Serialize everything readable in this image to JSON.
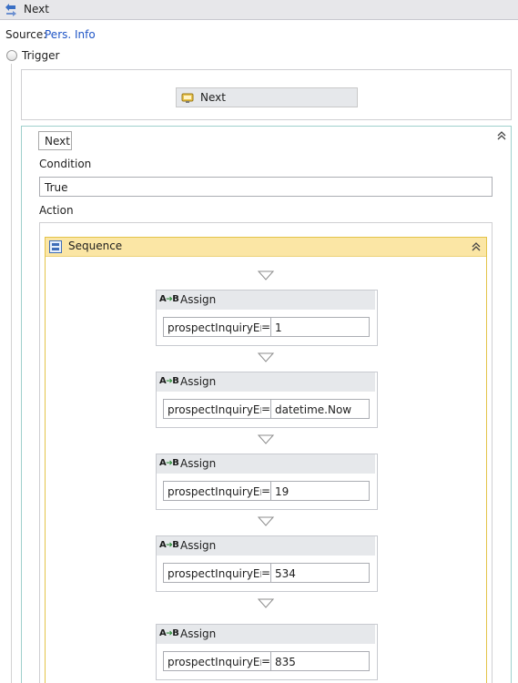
{
  "header": {
    "title": "Next",
    "icon": "transition-icon"
  },
  "source": {
    "label": "Source:",
    "link": "Pers. Info"
  },
  "trigger": {
    "label": "Trigger",
    "activity_label": "Next",
    "activity_icon": "trigger-activity-icon"
  },
  "transition": {
    "name": "Next",
    "condition_label": "Condition",
    "condition_value": "True",
    "action_label": "Action"
  },
  "sequence": {
    "title": "Sequence",
    "icon": "sequence-icon",
    "accent_color": "#fbe6a5"
  },
  "assigns": [
    {
      "title": "Assign",
      "to": "prospectInquiryEnt",
      "eq": "=",
      "value": "1"
    },
    {
      "title": "Assign",
      "to": "prospectInquiryEnt",
      "eq": "=",
      "value": "datetime.Now"
    },
    {
      "title": "Assign",
      "to": "prospectInquiryEnt",
      "eq": "=",
      "value": "19"
    },
    {
      "title": "Assign",
      "to": "prospectInquiryEnt",
      "eq": "=",
      "value": "534"
    },
    {
      "title": "Assign",
      "to": "prospectInquiryEnt",
      "eq": "=",
      "value": "835"
    }
  ]
}
